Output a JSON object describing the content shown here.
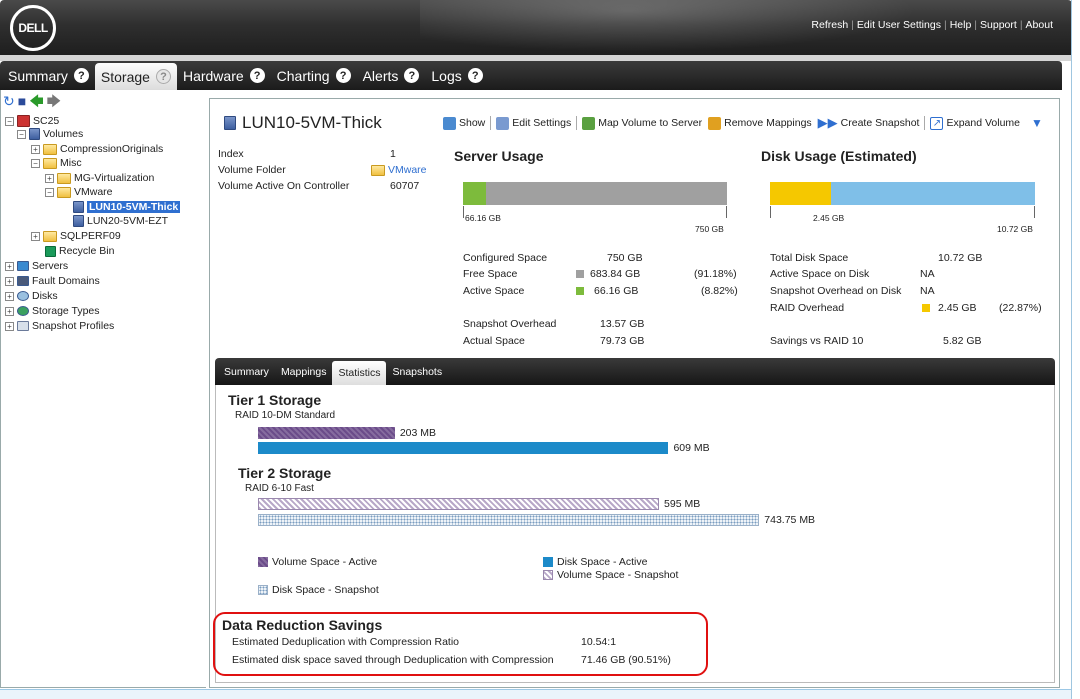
{
  "brand": {
    "logo_text": "DELL"
  },
  "top_links": [
    "Refresh",
    "Edit User Settings",
    "Help",
    "Support",
    "About"
  ],
  "tabs": [
    {
      "label": "Summary"
    },
    {
      "label": "Storage"
    },
    {
      "label": "Hardware"
    },
    {
      "label": "Charting"
    },
    {
      "label": "Alerts"
    },
    {
      "label": "Logs"
    }
  ],
  "tree": {
    "root": "SC25",
    "volumes": "Volumes",
    "compression_originals": "CompressionOriginals",
    "misc": "Misc",
    "mg_virtualization": "MG-Virtualization",
    "vmware": "VMware",
    "lun10": "LUN10-5VM-Thick",
    "lun20": "LUN20-5VM-EZT",
    "sqlperf": "SQLPERF09",
    "recycle": "Recycle Bin",
    "servers": "Servers",
    "fault_domains": "Fault Domains",
    "disks": "Disks",
    "storage_types": "Storage Types",
    "snapshot_profiles": "Snapshot Profiles"
  },
  "volume": {
    "title": "LUN10-5VM-Thick",
    "toolbar": {
      "show": "Show",
      "edit_settings": "Edit Settings",
      "map": "Map Volume to Server",
      "remove_mappings": "Remove Mappings",
      "create_snapshot": "Create Snapshot",
      "expand": "Expand Volume"
    },
    "info": {
      "index_label": "Index",
      "index_value": "1",
      "folder_label": "Volume Folder",
      "folder_value": "VMware",
      "controller_label": "Volume Active On Controller",
      "controller_value": "60707"
    }
  },
  "server_usage": {
    "title": "Server Usage",
    "used_fraction": 0.0882,
    "bar_left_label": "66.16 GB",
    "bar_right_label": "750 GB",
    "rows": [
      {
        "label": "Configured Space",
        "value": "750 GB",
        "pct": ""
      },
      {
        "label": "Free Space",
        "value": "683.84 GB",
        "pct": "(91.18%)"
      },
      {
        "label": "Active Space",
        "value": "66.16 GB",
        "pct": "(8.82%)"
      },
      {
        "label": "Snapshot Overhead",
        "value": "13.57 GB",
        "pct": ""
      },
      {
        "label": "Actual Space",
        "value": "79.73 GB",
        "pct": ""
      }
    ],
    "colors": {
      "free": "#a0a0a0",
      "active": "#7dbb3c"
    }
  },
  "disk_usage": {
    "title": "Disk Usage (Estimated)",
    "used_fraction": 0.2287,
    "bar_left_label": "2.45 GB",
    "bar_right_label": "10.72 GB",
    "rows": [
      {
        "label": "Total Disk Space",
        "value": "10.72 GB",
        "pct": ""
      },
      {
        "label": "Active Space on Disk",
        "value": "NA",
        "pct": ""
      },
      {
        "label": "Snapshot Overhead on Disk",
        "value": "NA",
        "pct": ""
      },
      {
        "label": "RAID Overhead",
        "value": "2.45 GB",
        "pct": "(22.87%)"
      },
      {
        "label": "Savings vs RAID 10",
        "value": "5.82 GB",
        "pct": ""
      }
    ],
    "colors": {
      "raid": "#f5c800",
      "rest": "#7fbfe8"
    }
  },
  "subtabs": [
    "Summary",
    "Mappings",
    "Statistics",
    "Snapshots"
  ],
  "tier1": {
    "title": "Tier 1 Storage",
    "raid": "RAID 10-DM Standard",
    "volume_active": "203 MB",
    "disk_active": "609 MB",
    "volume_active_mb": 203,
    "disk_active_mb": 609
  },
  "tier2": {
    "title": "Tier 2 Storage",
    "raid": "RAID 6-10 Fast",
    "volume_snapshot": "595 MB",
    "disk_snapshot": "743.75 MB",
    "volume_snapshot_mb": 595,
    "disk_snapshot_mb": 743.75
  },
  "legend": {
    "volume_active": "Volume Space - Active",
    "disk_active": "Disk Space - Active",
    "volume_snapshot": "Volume Space - Snapshot",
    "disk_snapshot": "Disk Space - Snapshot"
  },
  "data_reduction": {
    "title": "Data Reduction Savings",
    "ratio_label": "Estimated Deduplication with Compression Ratio",
    "ratio_value": "10.54:1",
    "saved_label": "Estimated disk space saved through Deduplication with Compression",
    "saved_value": "71.46 GB (90.51%)"
  }
}
